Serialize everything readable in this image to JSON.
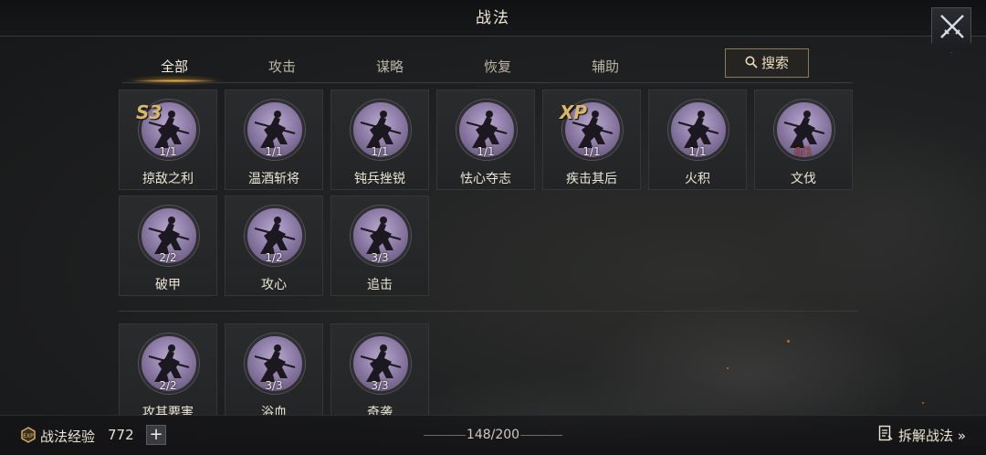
{
  "header": {
    "title": "战法"
  },
  "tabs": [
    {
      "label": "全部",
      "active": true
    },
    {
      "label": "攻击",
      "active": false
    },
    {
      "label": "谋略",
      "active": false
    },
    {
      "label": "恢复",
      "active": false
    },
    {
      "label": "辅助",
      "active": false
    }
  ],
  "search": {
    "label": "搜索",
    "icon": "search-icon"
  },
  "cards": [
    {
      "name": "掠敌之利",
      "count": "1/1",
      "badge": "S3"
    },
    {
      "name": "温酒斩将",
      "count": "1/1",
      "badge": ""
    },
    {
      "name": "钝兵挫锐",
      "count": "1/1",
      "badge": ""
    },
    {
      "name": "怯心夺志",
      "count": "1/1",
      "badge": ""
    },
    {
      "name": "疾击其后",
      "count": "1/1",
      "badge": "XP"
    },
    {
      "name": "火积",
      "count": "1/1",
      "badge": ""
    },
    {
      "name": "文伐",
      "count": "0/1",
      "badge": "",
      "count_color": "#c84a3a"
    },
    {
      "name": "破甲",
      "count": "2/2",
      "badge": ""
    },
    {
      "name": "攻心",
      "count": "1/2",
      "badge": ""
    },
    {
      "name": "追击",
      "count": "3/3",
      "badge": ""
    },
    {
      "name": "攻其要害",
      "count": "2/2",
      "badge": ""
    },
    {
      "name": "浴血",
      "count": "3/3",
      "badge": ""
    },
    {
      "name": "奇袭",
      "count": "3/3",
      "badge": ""
    }
  ],
  "footer": {
    "exp_label": "战法经验",
    "exp_value": "772",
    "plus_label": "+",
    "page_count": "148/200",
    "decompose_label": "拆解战法 »"
  },
  "colors": {
    "accent": "#f0c050",
    "badge": "#d9b768",
    "alert": "#c84a3a"
  }
}
